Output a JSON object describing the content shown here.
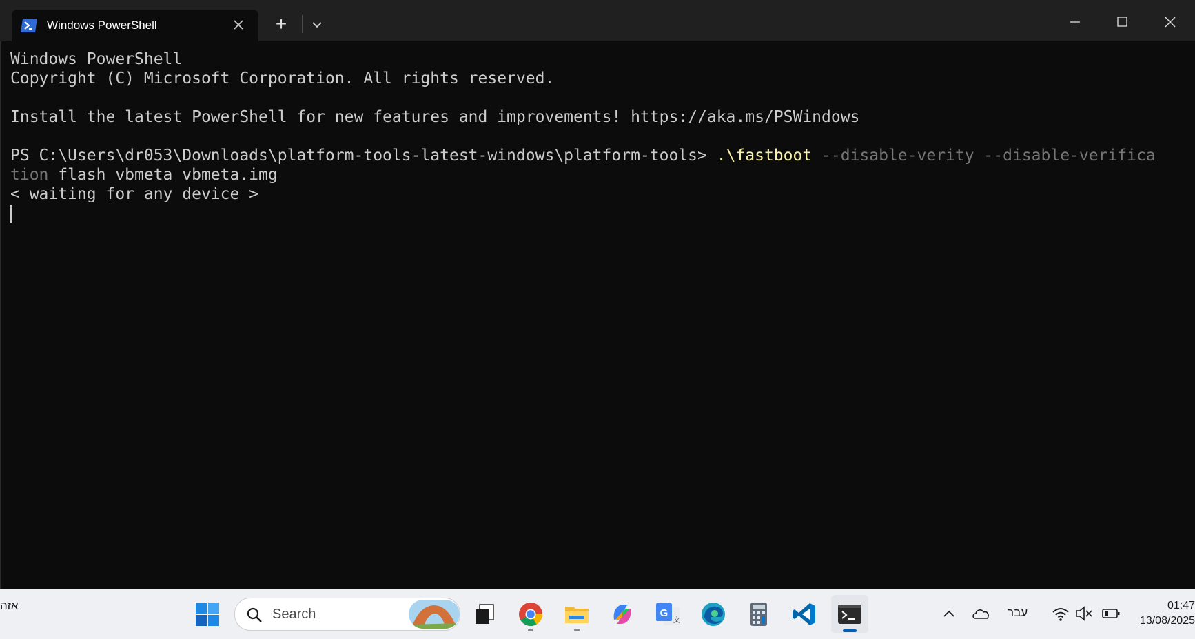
{
  "window": {
    "tab_title": "Windows PowerShell",
    "tab_icon": "powershell-icon",
    "new_tab_label": "+",
    "close_tab_label": "✕"
  },
  "terminal": {
    "lines": [
      "Windows PowerShell",
      "Copyright (C) Microsoft Corporation. All rights reserved.",
      "",
      "Install the latest PowerShell for new features and improvements! https://aka.ms/PSWindows",
      ""
    ],
    "prompt": "PS C:\\Users\\dr053\\Downloads\\platform-tools-latest-windows\\platform-tools> ",
    "command": ".\\fastboot",
    "args_wrapped_part1": " --disable-verity --disable-verifica",
    "args_wrapped_part2": "tion",
    "args_rest": " flash vbmeta vbmeta.img",
    "output": "< waiting for any device >",
    "colors": {
      "background": "#0c0c0c",
      "text": "#cccccc",
      "command": "#f9f1a5",
      "parameter": "#767676"
    }
  },
  "taskbar": {
    "left_text": "אזה",
    "search_placeholder": "Search",
    "apps": [
      "windows-start-icon",
      "task-view-icon",
      "chrome-icon",
      "file-explorer-icon",
      "copilot-icon",
      "google-translate-icon",
      "edge-icon",
      "calculator-icon",
      "vscode-icon",
      "terminal-icon"
    ],
    "tray": {
      "language": "עבר",
      "time": "01:47",
      "date": "13/08/2025"
    },
    "accent": "#005fb8"
  }
}
